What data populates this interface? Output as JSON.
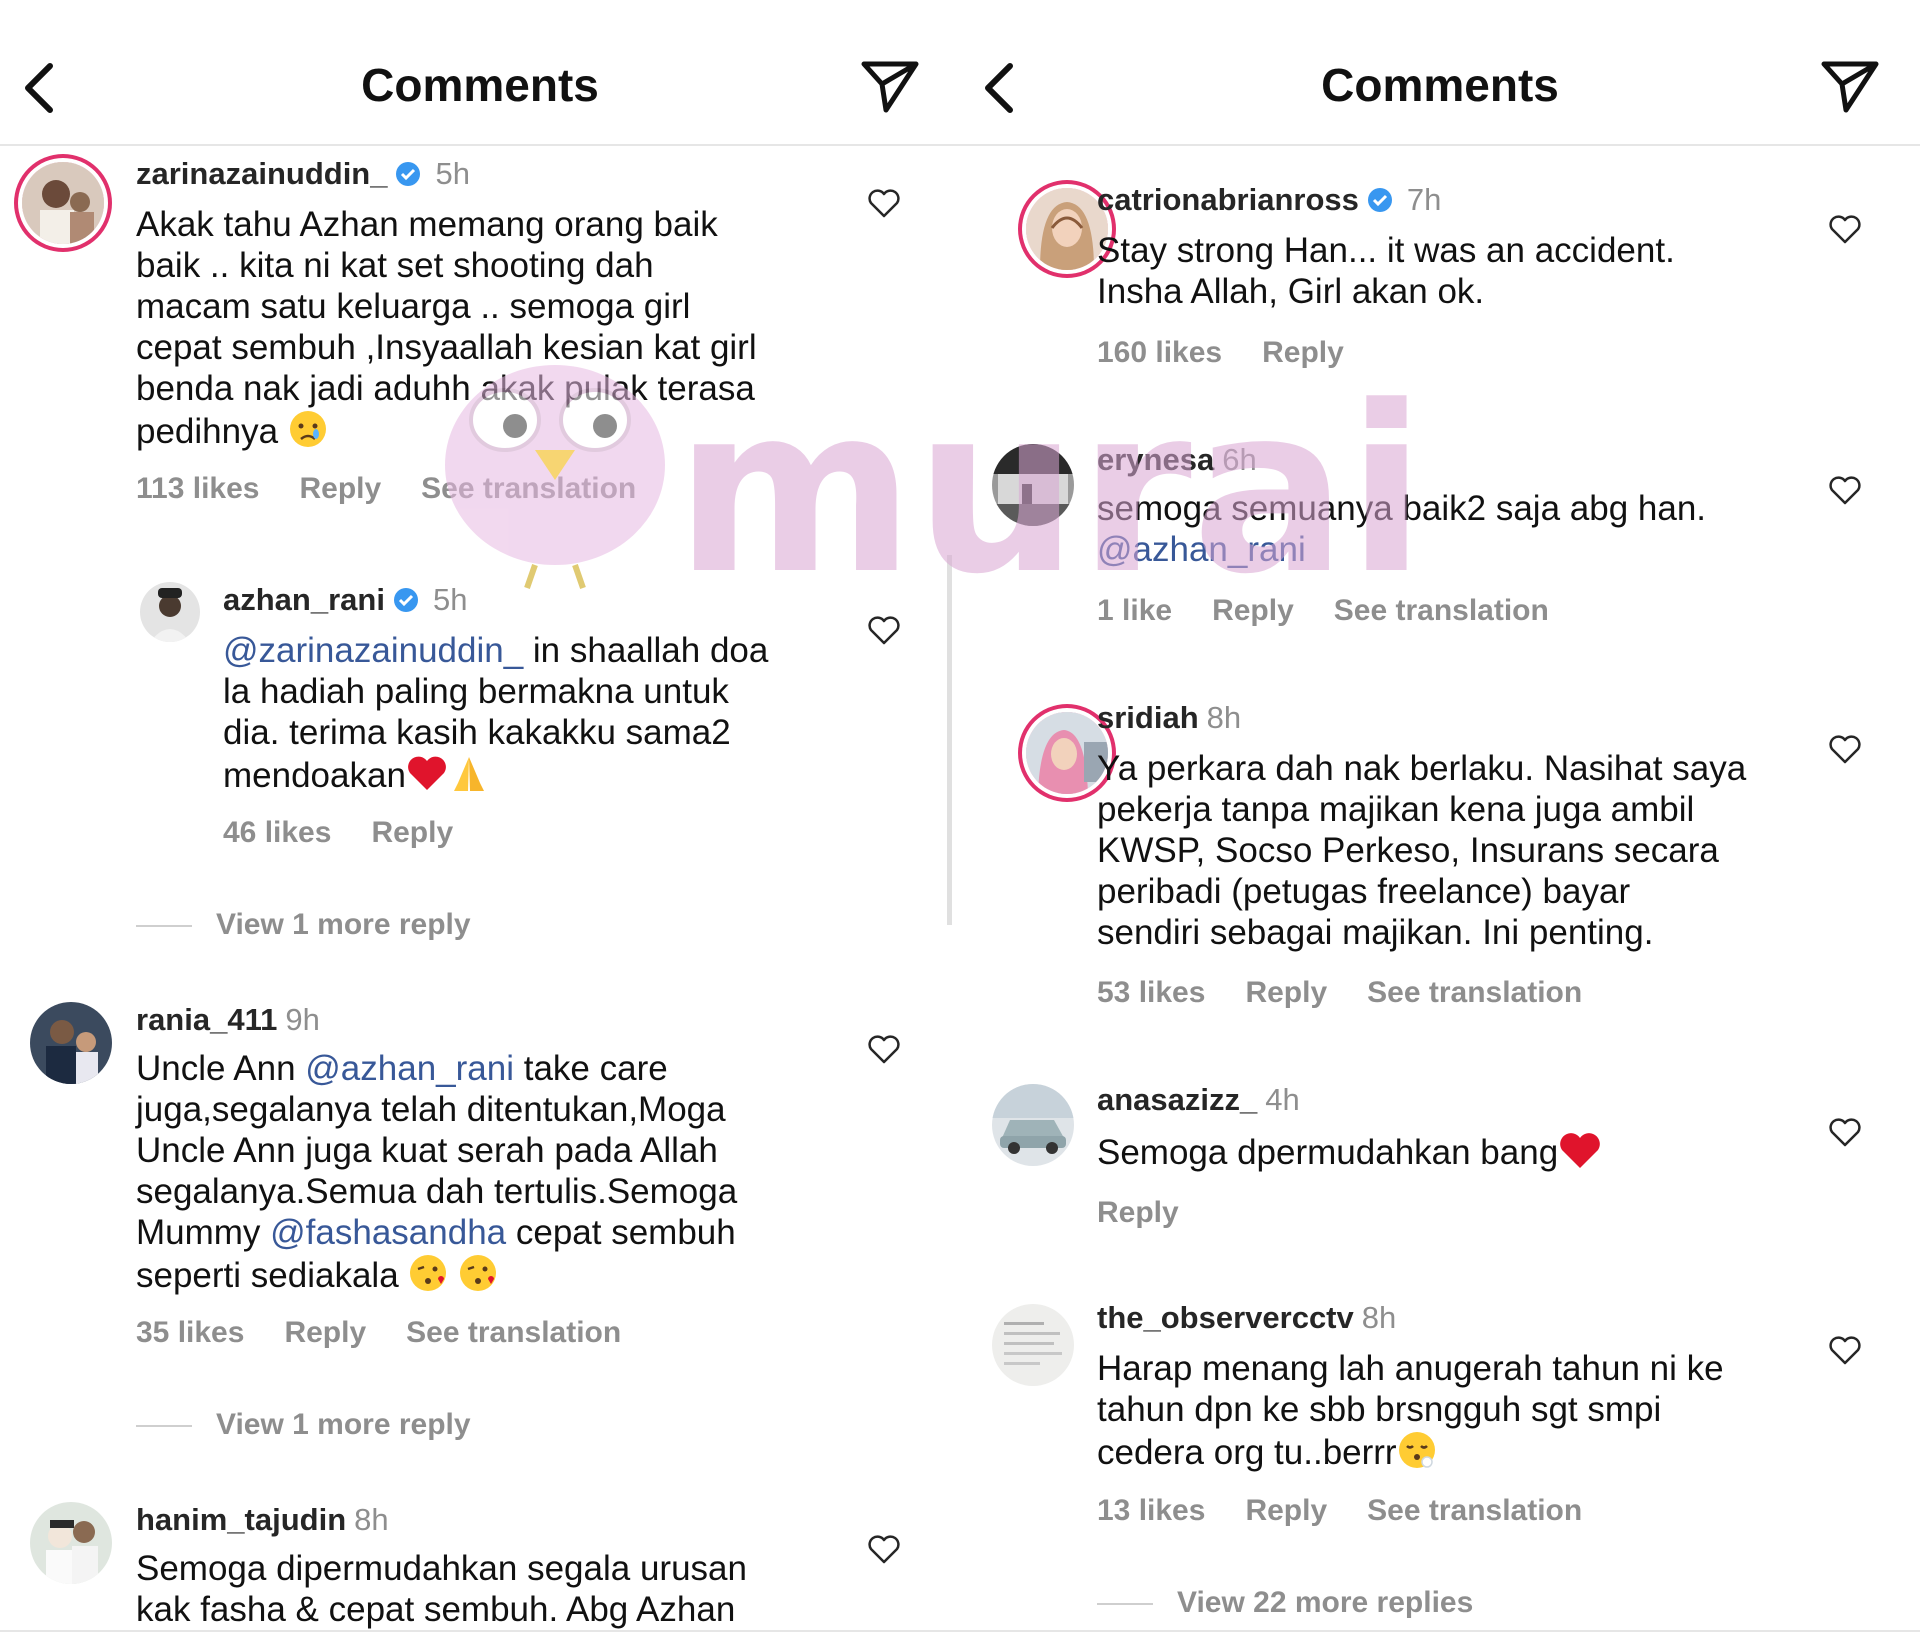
{
  "left": {
    "title": "Comments",
    "comments": [
      {
        "user": "zarinazainuddin_",
        "time": "5h",
        "verified": true,
        "lines": [
          "Akak tahu Azhan memang orang baik",
          "baik .. kita ni kat set shooting dah",
          "macam satu keluarga .. semoga girl",
          "cepat sembuh ,Insyaallah kesian kat girl",
          "benda nak jadi aduhh akak pulak terasa",
          "pedihnya"
        ],
        "likes": "113 likes",
        "reply": "Reply",
        "translate": "See translation"
      },
      {
        "user": "azhan_rani",
        "time": "5h",
        "verified": true,
        "mention": "@zarinazainuddin_",
        "first_line_rest": " in shaallah doa",
        "lines": [
          "la hadiah paling bermakna untuk",
          "dia. terima kasih kakakku sama2",
          "mendoakan"
        ],
        "likes": "46 likes",
        "reply": "Reply",
        "view_more": "View 1 more reply"
      },
      {
        "user": "rania_411",
        "time": "9h",
        "line1_before": "Uncle Ann ",
        "mention1": "@azhan_rani",
        "line1_after": " take care",
        "lines": [
          "juga,segalanya telah ditentukan,Moga",
          "Uncle Ann juga kuat serah pada Allah",
          "segalanya.Semua dah tertulis.Semoga"
        ],
        "line5_before": "Mummy ",
        "mention2": "@fashasandha",
        "line5_after": " cepat sembuh",
        "line6": "seperti sediakala",
        "likes": "35 likes",
        "reply": "Reply",
        "translate": "See translation",
        "view_more": "View 1 more reply"
      },
      {
        "user": "hanim_tajudin",
        "time": "8h",
        "lines": [
          "Semoga dipermudahkan segala urusan",
          "kak fasha & cepat sembuh. Abg Azhan"
        ]
      }
    ]
  },
  "right": {
    "title": "Comments",
    "comments": [
      {
        "user": "catrionabrianross",
        "time": "7h",
        "verified": true,
        "lines": [
          "Stay strong Han... it was an accident.",
          "Insha Allah, Girl akan ok."
        ],
        "likes": "160 likes",
        "reply": "Reply"
      },
      {
        "user": "erynesa",
        "time": "6h",
        "lines": [
          "semoga semuanya baik2 saja abg han."
        ],
        "mention": "@azhan_rani",
        "likes": "1 like",
        "reply": "Reply",
        "translate": "See translation"
      },
      {
        "user": "sridiah",
        "time": "8h",
        "lines": [
          "Ya perkara dah nak berlaku. Nasihat saya",
          "pekerja tanpa majikan kena juga ambil",
          "KWSP, Socso Perkeso, Insurans secara",
          "peribadi (petugas freelance) bayar",
          "sendiri sebagai majikan. Ini penting."
        ],
        "likes": "53 likes",
        "reply": "Reply",
        "translate": "See translation"
      },
      {
        "user": "anasazizz_",
        "time": "4h",
        "lines": [
          "Semoga dpermudahkan bang"
        ],
        "reply": "Reply"
      },
      {
        "user": "the_observercctv",
        "time": "8h",
        "lines": [
          "Harap menang lah anugerah tahun ni ke",
          "tahun dpn ke sbb brsngguh sgt smpi",
          "cedera org tu..berrr"
        ],
        "likes": "13 likes",
        "reply": "Reply",
        "translate": "See translation",
        "view_more": "View 22 more replies"
      }
    ]
  },
  "watermark_text": "murai",
  "colors": {
    "mention": "#385898",
    "secondary": "#8e8e8e",
    "verified": "#3897f0",
    "ring": "#e1306c",
    "watermark": "#e8c4e4"
  }
}
